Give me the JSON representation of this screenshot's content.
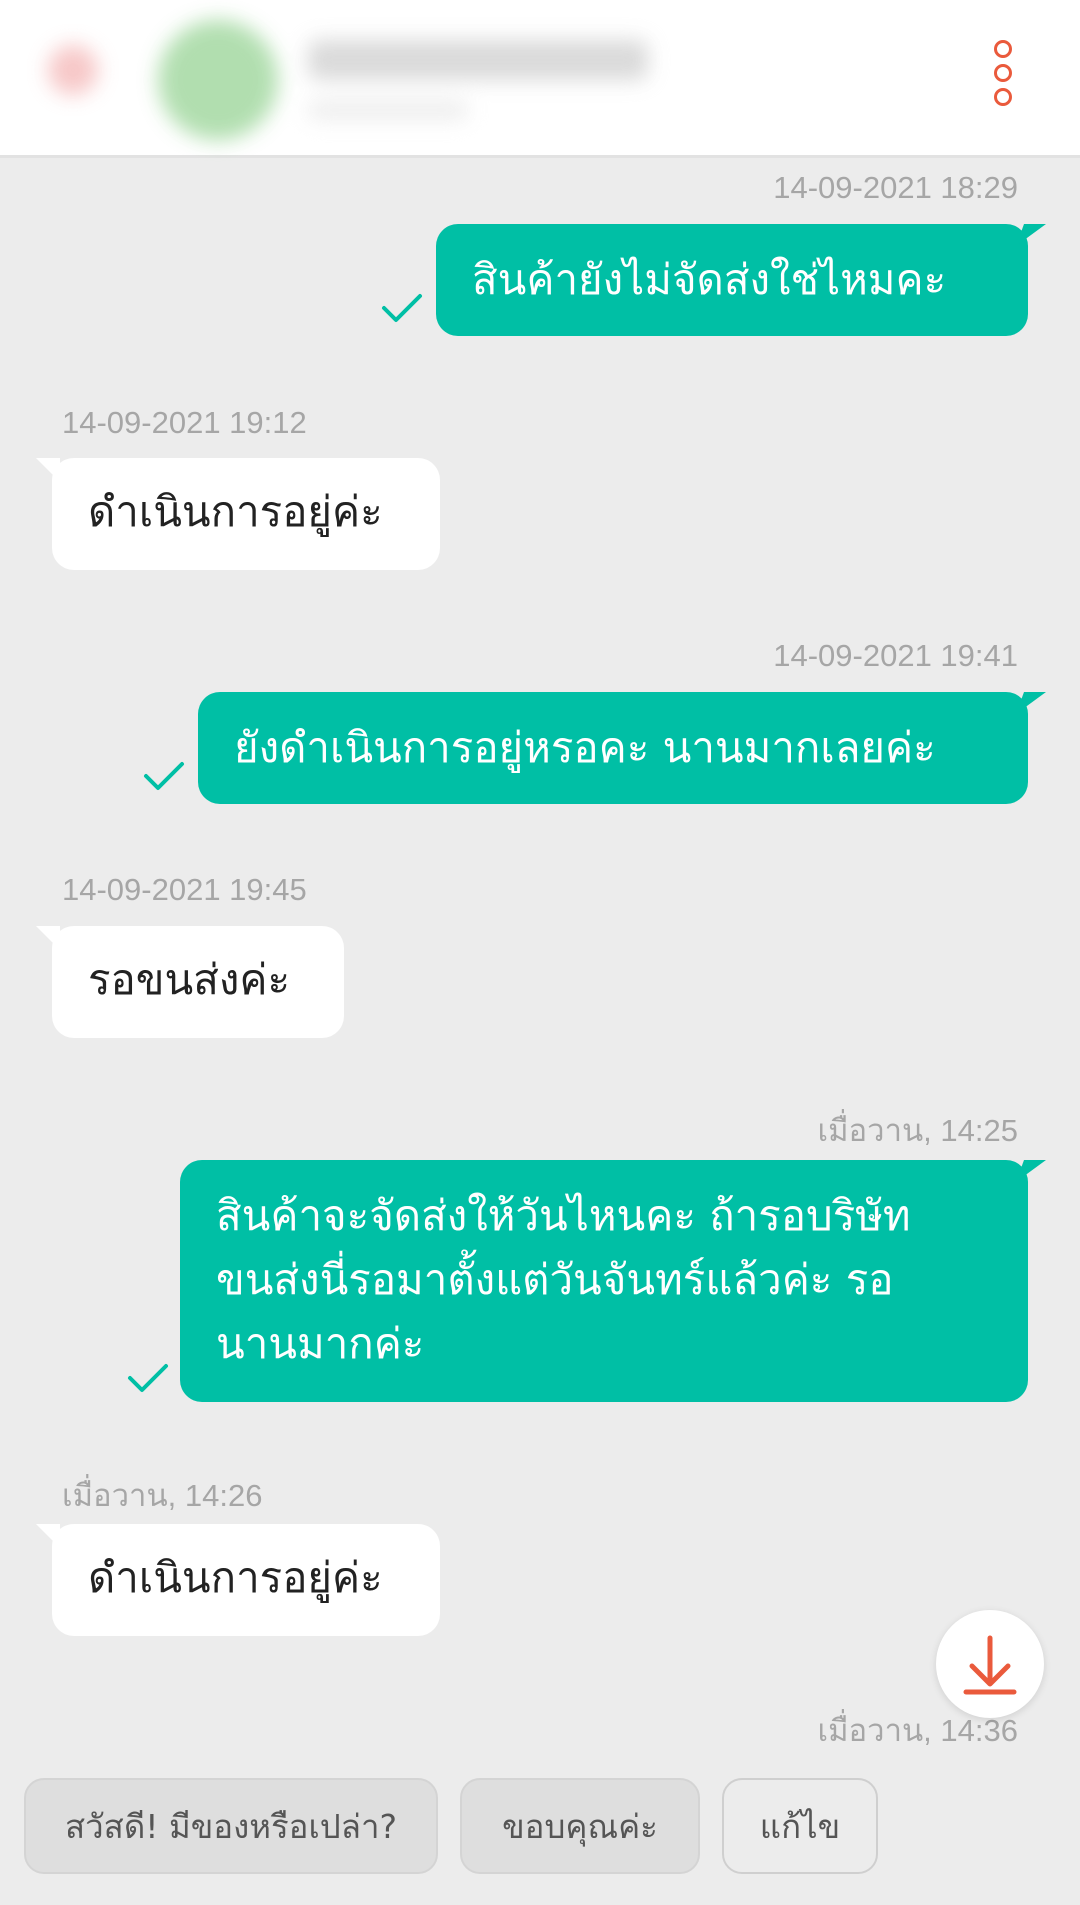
{
  "header": {
    "more_icon": "vertical-ellipsis-icon",
    "accent_color": "#ea5a3c"
  },
  "messages": [
    {
      "direction": "out",
      "timestamp": "14-09-2021 18:29",
      "lines": [
        "สินค้ายังไม่จัดส่งใช่ไหมคะ"
      ],
      "status_icon": "check-icon"
    },
    {
      "direction": "in",
      "timestamp": "14-09-2021 19:12",
      "lines": [
        "ดำเนินการอยู่ค่ะ"
      ]
    },
    {
      "direction": "out",
      "timestamp": "14-09-2021 19:41",
      "lines": [
        "ยังดำเนินการอยู่หรอคะ นานมากเลยค่ะ"
      ],
      "status_icon": "check-icon"
    },
    {
      "direction": "in",
      "timestamp": "14-09-2021 19:45",
      "lines": [
        "รอขนส่งค่ะ"
      ]
    },
    {
      "direction": "out",
      "timestamp": "เมื่อวาน, 14:25",
      "lines": [
        "สินค้าจะจัดส่งให้วันไหนคะ ถ้ารอบริษัท",
        "ขนส่งนี่รอมาตั้งแต่วันจันทร์แล้วค่ะ รอ",
        "นานมากค่ะ"
      ],
      "status_icon": "check-icon"
    },
    {
      "direction": "in",
      "timestamp": "เมื่อวาน, 14:26",
      "lines": [
        "ดำเนินการอยู่ค่ะ"
      ]
    }
  ],
  "partial_timestamp": "เมื่อวาน, 14:36",
  "scroll_button_icon": "arrow-down-to-line-icon",
  "quick_replies": [
    {
      "label": "สวัสดี! มีของหรือเปล่า?"
    },
    {
      "label": "ขอบคุณค่ะ"
    },
    {
      "label": "แก้ไข"
    }
  ],
  "colors": {
    "outgoing_bubble": "#00bfa5",
    "incoming_bubble": "#ffffff",
    "background": "#ececec",
    "timestamp": "#a6a6a6"
  }
}
